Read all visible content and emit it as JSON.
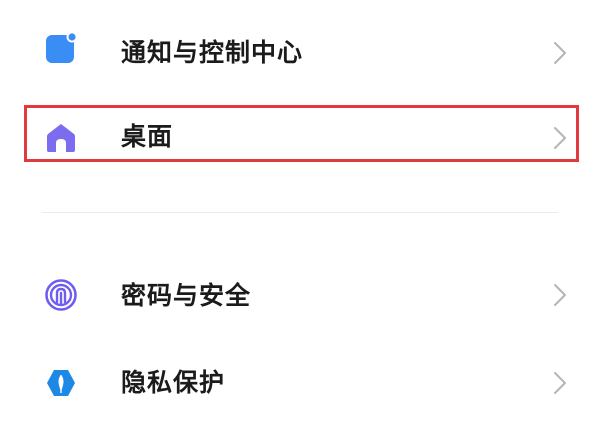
{
  "settings": {
    "items": [
      {
        "label": "通知与控制中心",
        "icon": "notification-icon",
        "color": "#3a8df5"
      },
      {
        "label": "桌面",
        "icon": "home-icon",
        "color": "#7b6cf0"
      },
      {
        "label": "密码与安全",
        "icon": "fingerprint-icon",
        "color": "#6f5df0"
      },
      {
        "label": "隐私保护",
        "icon": "privacy-shield-icon",
        "color": "#1e88e5"
      }
    ]
  },
  "highlight": {
    "target": "桌面",
    "color": "#e0393e"
  },
  "chevron_color": "#b5b5b5"
}
